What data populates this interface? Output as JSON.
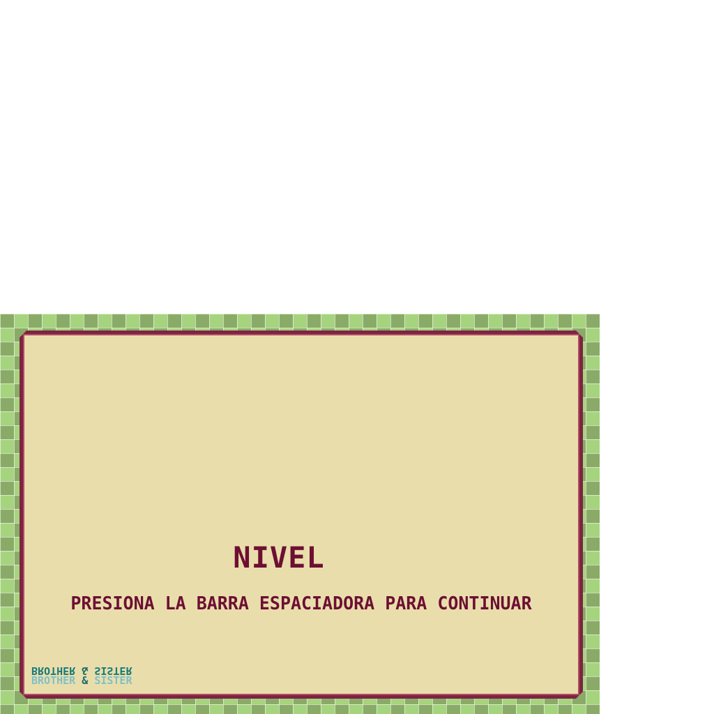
{
  "level": {
    "title": "NIVEL",
    "prompt": "PRESIONA LA BARRA ESPACIADORA PARA CONTINUAR"
  },
  "logo": {
    "word1": "BROTHER",
    "amp": "&",
    "word2": "SISTER"
  },
  "colors": {
    "text": "#6d0f33",
    "panel": "#e9deab",
    "border": "#7d2440",
    "tile_light": "#a6d47e",
    "tile_dark": "#8aab68",
    "logo_dark": "#1a7a7a",
    "logo_light": "#7fc0c6"
  }
}
